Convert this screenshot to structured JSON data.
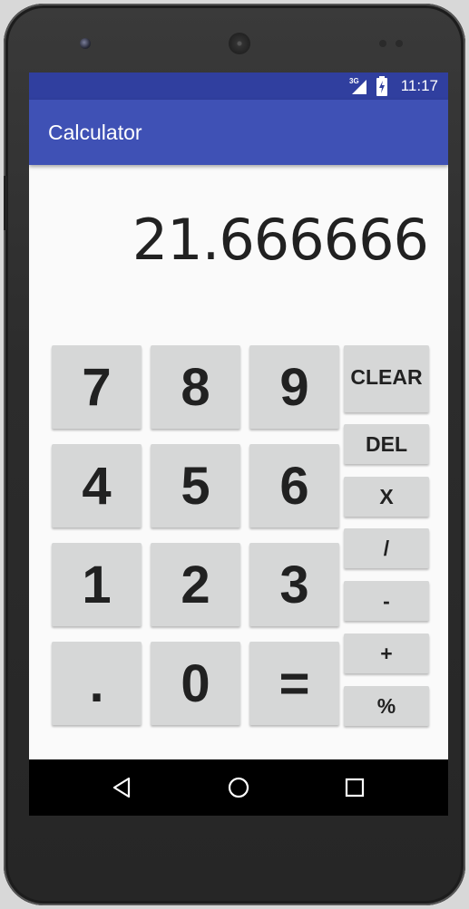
{
  "status_bar": {
    "network": "3G",
    "time": "11:17"
  },
  "app_bar": {
    "title": "Calculator"
  },
  "display": {
    "value": "21.666666"
  },
  "keypad": {
    "digits": [
      {
        "name": "key-7",
        "label": "7"
      },
      {
        "name": "key-8",
        "label": "8"
      },
      {
        "name": "key-9",
        "label": "9"
      },
      {
        "name": "key-4",
        "label": "4"
      },
      {
        "name": "key-5",
        "label": "5"
      },
      {
        "name": "key-6",
        "label": "6"
      },
      {
        "name": "key-1",
        "label": "1"
      },
      {
        "name": "key-2",
        "label": "2"
      },
      {
        "name": "key-3",
        "label": "3"
      },
      {
        "name": "key-decimal",
        "label": "."
      },
      {
        "name": "key-0",
        "label": "0"
      },
      {
        "name": "key-equals",
        "label": "="
      }
    ],
    "operators": [
      {
        "name": "clear-button",
        "label": "CLEAR"
      },
      {
        "name": "delete-button",
        "label": "DEL"
      },
      {
        "name": "multiply-button",
        "label": "X"
      },
      {
        "name": "divide-button",
        "label": "/"
      },
      {
        "name": "subtract-button",
        "label": "-"
      },
      {
        "name": "add-button",
        "label": "+"
      },
      {
        "name": "percent-button",
        "label": "%"
      }
    ]
  },
  "nav_bar": {
    "icons": [
      "back-icon",
      "home-icon",
      "recents-icon"
    ]
  },
  "colors": {
    "primary": "#3f51b5",
    "primary_dark": "#303f9f",
    "key_background": "#d6d7d7",
    "screen_background": "#fafafa"
  }
}
